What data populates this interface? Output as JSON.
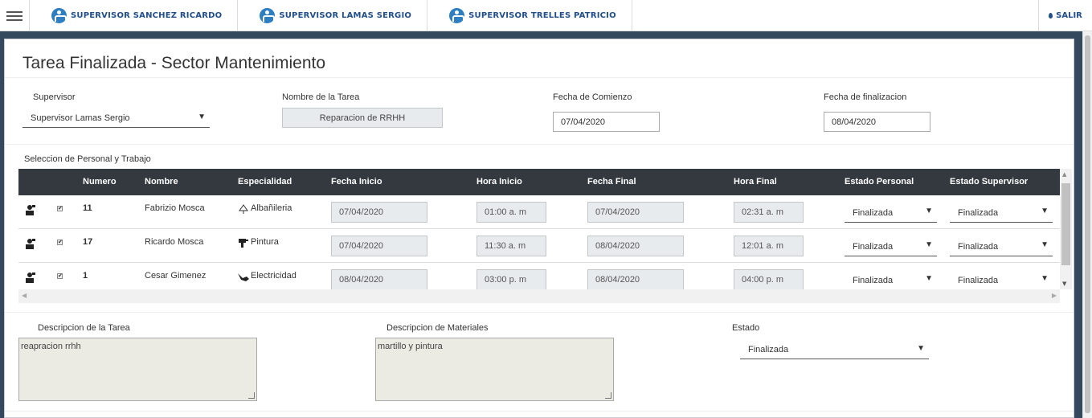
{
  "nav": {
    "items": [
      "SUPERVISOR SANCHEZ RICARDO",
      "SUPERVISOR LAMAS SERGIO",
      "SUPERVISOR TRELLES PATRICIO"
    ],
    "logout": "SALIR"
  },
  "page": {
    "title": "Tarea Finalizada - Sector Mantenimiento"
  },
  "form": {
    "supervisor_label": "Supervisor",
    "supervisor_value": "Supervisor Lamas Sergio",
    "task_name_label": "Nombre de la Tarea",
    "task_name_value": "Reparacion de RRHH",
    "start_date_label": "Fecha de Comienzo",
    "start_date_value": "07/04/2020",
    "end_date_label": "Fecha de finalizacion",
    "end_date_value": "08/04/2020"
  },
  "grid": {
    "section_label": "Seleccion de Personal y Trabajo",
    "columns": [
      "Numero",
      "Nombre",
      "Especialidad",
      "Fecha Inicio",
      "Hora Inicio",
      "Fecha Final",
      "Hora Final",
      "Estado Personal",
      "Estado Supervisor"
    ],
    "rows": [
      {
        "numero": "11",
        "nombre": "Fabrizio Mosca",
        "especialidad": "Albañileria",
        "fecha_inicio": "07/04/2020",
        "hora_inicio": "01:00 a. m",
        "fecha_final": "07/04/2020",
        "hora_final": "02:31 a. m",
        "estado_personal": "Finalizada",
        "estado_supervisor": "Finalizada",
        "check": "✔",
        "icon": "trowel-icon"
      },
      {
        "numero": "17",
        "nombre": "Ricardo Mosca",
        "especialidad": "Pintura",
        "fecha_inicio": "07/04/2020",
        "hora_inicio": "11:30 a. m",
        "fecha_final": "08/04/2020",
        "hora_final": "12:01 a. m",
        "estado_personal": "Finalizada",
        "estado_supervisor": "Finalizada",
        "check": "✔",
        "icon": "paint-gun-icon"
      },
      {
        "numero": "1",
        "nombre": "Cesar Gimenez",
        "especialidad": "Electricidad",
        "fecha_inicio": "08/04/2020",
        "hora_inicio": "03:00 p. m",
        "fecha_final": "08/04/2020",
        "hora_final": "04:00 p. m",
        "estado_personal": "Finalizada",
        "estado_supervisor": "Finalizada",
        "check": "✔",
        "icon": "plug-icon"
      }
    ]
  },
  "bottom": {
    "task_desc_label": "Descripcion de la Tarea",
    "task_desc_value": "reapracion rrhh",
    "materials_label": "Descripcion de Materiales",
    "materials_value": "martillo y pintura",
    "status_label": "Estado",
    "status_value": "Finalizada"
  },
  "glyphs": {
    "caret": "▼",
    "scroll_up": "▲",
    "scroll_down": "▼",
    "scroll_left": "◀",
    "scroll_right": "▶"
  },
  "colors": {
    "nav_text": "#1f4e8a",
    "header_bg": "#34393f",
    "frame": "#34495e"
  }
}
